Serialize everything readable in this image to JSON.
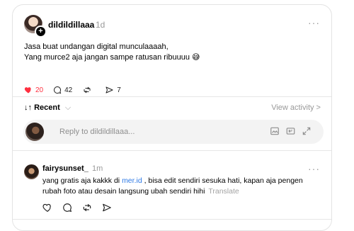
{
  "post": {
    "username": "dildildillaaa",
    "time": "1d",
    "more": "···",
    "text_line1": "Jasa buat undangan digital munculaaaah,",
    "text_line2": "Yang murce2 aja jangan sampe ratusan ribuuuu 😅",
    "likes": "20",
    "comments": "42",
    "shares": "7"
  },
  "section": {
    "title": "Recent",
    "title_prefix": "↓↑",
    "chevron": "⌵",
    "view_activity": "View activity >"
  },
  "reply": {
    "placeholder": "Reply to dildildillaaa..."
  },
  "comment": {
    "username": "fairysunset_",
    "time": "1m",
    "more": "···",
    "text_before_link": "yang gratis aja kakkk di ",
    "link": "mer.id",
    "text_after_link": " , bisa edit sendiri sesuka hati, kapan aja pengen",
    "line2": "rubah foto atau desain langsung ubah sendiri hihi",
    "translate": "Translate"
  },
  "colors": {
    "accent_like": "#ff3040",
    "link": "#2f7ae5",
    "muted": "#999999"
  },
  "icons": {
    "like": "heart-filled-icon",
    "comment": "comment-icon",
    "repost": "repost-icon",
    "share": "share-icon"
  }
}
